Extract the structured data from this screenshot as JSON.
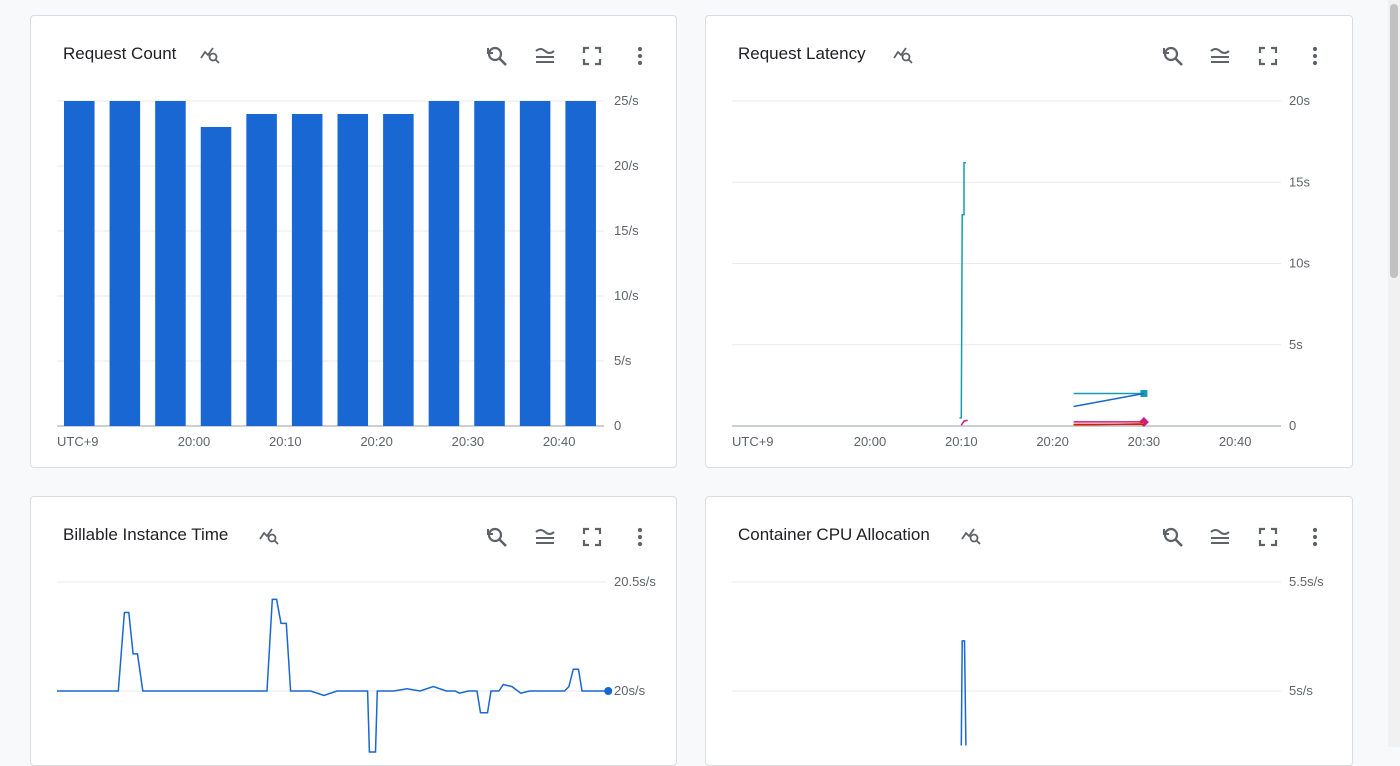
{
  "cards": [
    {
      "id": "request-count",
      "title": "Request Count",
      "chart_data": {
        "type": "bar",
        "title": "Request Count",
        "timezone": "UTC+9",
        "x_tick_labels": [
          "20:00",
          "20:10",
          "20:20",
          "20:30",
          "20:40"
        ],
        "y_tick_labels": [
          "25/s",
          "20/s",
          "15/s",
          "10/s",
          "5/s",
          "0"
        ],
        "ylim": [
          0,
          25
        ],
        "values": [
          25,
          25,
          25,
          23,
          24,
          24,
          24,
          24,
          25,
          25,
          25,
          25
        ],
        "color": "#1967d2",
        "grid": true
      }
    },
    {
      "id": "request-latency",
      "title": "Request Latency",
      "chart_data": {
        "type": "line",
        "title": "Request Latency",
        "timezone": "UTC+9",
        "x_tick_labels": [
          "20:00",
          "20:10",
          "20:20",
          "20:30",
          "20:40"
        ],
        "y_tick_labels": [
          "20s",
          "15s",
          "10s",
          "5s",
          "0"
        ],
        "ylim": [
          0,
          20
        ],
        "grid": true,
        "series": [
          {
            "color": "#129eaf",
            "points": [
              [
                9.8,
                0.5
              ],
              [
                10.0,
                0.5
              ],
              [
                10.1,
                13.0
              ],
              [
                10.3,
                13.0
              ],
              [
                10.3,
                16.2
              ],
              [
                10.5,
                16.2
              ]
            ],
            "marker": "none"
          },
          {
            "color": "#129eaf",
            "points": [
              [
                22.3,
                2.0
              ],
              [
                30.0,
                2.0
              ]
            ],
            "marker": "square"
          },
          {
            "color": "#1967d2",
            "points": [
              [
                22.3,
                1.2
              ],
              [
                30.0,
                2.0
              ]
            ],
            "marker": "none"
          },
          {
            "color": "#d01884",
            "points": [
              [
                10.0,
                0.05
              ],
              [
                10.3,
                0.3
              ],
              [
                10.7,
                0.35
              ]
            ],
            "marker": "none"
          },
          {
            "color": "#d01884",
            "points": [
              [
                22.3,
                0.25
              ],
              [
                30.0,
                0.25
              ]
            ],
            "marker": "diamond"
          },
          {
            "color": "#e8710a",
            "points": [
              [
                22.3,
                0.05
              ],
              [
                30.0,
                0.15
              ]
            ],
            "marker": "none"
          },
          {
            "color": "#c5221f",
            "points": [
              [
                22.3,
                0.1
              ],
              [
                30.0,
                0.1
              ]
            ],
            "marker": "none"
          }
        ]
      }
    },
    {
      "id": "billable-instance-time",
      "title": "Billable Instance Time",
      "chart_data": {
        "type": "line",
        "title": "Billable Instance Time",
        "y_tick_labels": [
          "20.5s/s",
          "20s/s"
        ],
        "y_ticks": [
          20.5,
          20
        ],
        "grid": true,
        "series": [
          {
            "color": "#1967d2",
            "marker": "end-dot",
            "points": [
              [
                0,
                20
              ],
              [
                7,
                20
              ],
              [
                7.7,
                20.36
              ],
              [
                8.2,
                20.36
              ],
              [
                8.7,
                20.17
              ],
              [
                9.2,
                20.17
              ],
              [
                9.8,
                20
              ],
              [
                24,
                20
              ],
              [
                24.6,
                20.42
              ],
              [
                25.1,
                20.42
              ],
              [
                25.6,
                20.31
              ],
              [
                26.2,
                20.31
              ],
              [
                26.7,
                20
              ],
              [
                29,
                20
              ],
              [
                30.5,
                19.98
              ],
              [
                32,
                20
              ],
              [
                35.5,
                20
              ],
              [
                35.7,
                19.72
              ],
              [
                36.4,
                19.72
              ],
              [
                36.6,
                20
              ],
              [
                38.5,
                20
              ],
              [
                40,
                20.01
              ],
              [
                41.5,
                20
              ],
              [
                43,
                20.02
              ],
              [
                44.5,
                20
              ],
              [
                45.5,
                20
              ],
              [
                46,
                19.99
              ],
              [
                47,
                20
              ],
              [
                48,
                20
              ],
              [
                48.4,
                19.9
              ],
              [
                49.2,
                19.9
              ],
              [
                49.6,
                20
              ],
              [
                50.5,
                20
              ],
              [
                51,
                20.03
              ],
              [
                52,
                20.02
              ],
              [
                53,
                19.99
              ],
              [
                54,
                20
              ],
              [
                58,
                20
              ],
              [
                58.5,
                20.02
              ],
              [
                59,
                20.1
              ],
              [
                59.6,
                20.1
              ],
              [
                60,
                20
              ],
              [
                63,
                20
              ]
            ]
          }
        ]
      }
    },
    {
      "id": "container-cpu-allocation",
      "title": "Container CPU Allocation",
      "chart_data": {
        "type": "line",
        "title": "Container CPU Allocation",
        "y_tick_labels": [
          "5.5s/s",
          "5s/s"
        ],
        "y_ticks": [
          5.5,
          5
        ],
        "grid": true,
        "series": [
          {
            "color": "#1967d2",
            "marker": "none",
            "points": [
              [
                10.0,
                4.75
              ],
              [
                10.1,
                5.23
              ],
              [
                10.35,
                5.23
              ],
              [
                10.5,
                4.75
              ]
            ]
          }
        ]
      }
    }
  ],
  "toolbar": {
    "explore_icon": "chart-search-icon",
    "reset_zoom_icon": "reset-zoom-icon",
    "legend_icon": "legend-toggle-icon",
    "fullscreen_icon": "fullscreen-icon",
    "menu_icon": "more-vert-icon"
  },
  "colors": {
    "bar": "#1967d2",
    "icon": "#5f6368",
    "grid": "#e8eaed",
    "axis": "#9aa0a6"
  }
}
